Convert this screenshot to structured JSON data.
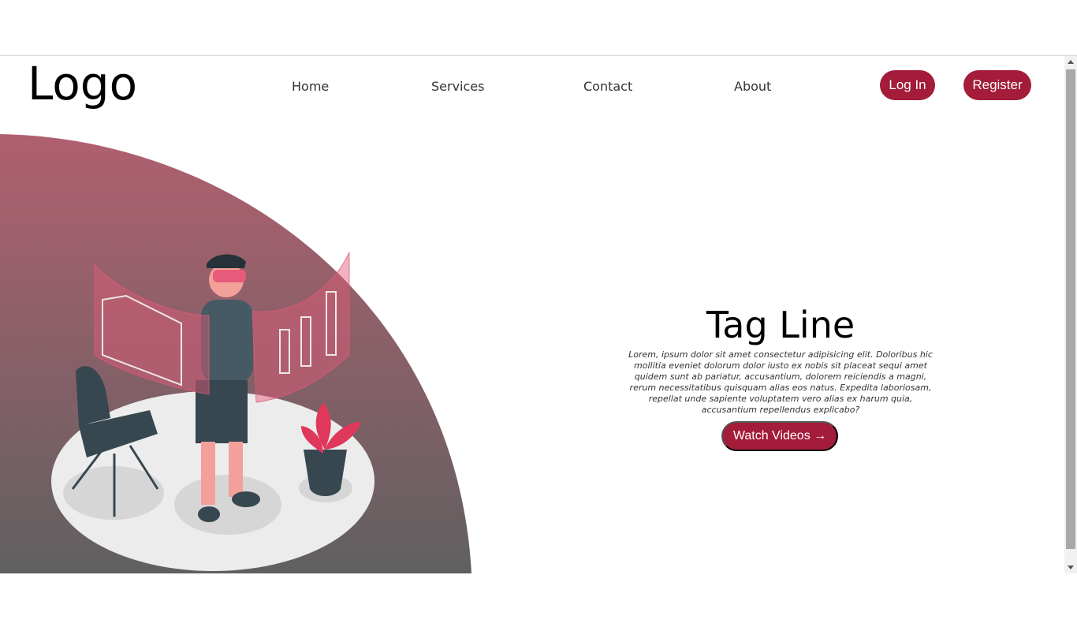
{
  "header": {
    "logo": "Logo",
    "nav": [
      "Home",
      "Services",
      "Contact",
      "About"
    ],
    "login": "Log In",
    "register": "Register"
  },
  "hero": {
    "tagline": "Tag Line",
    "description": "Lorem, ipsum dolor sit amet consectetur adipisicing elit. Doloribus hic mollitia eveniet dolorum dolor iusto ex nobis sit placeat sequi amet quidem sunt ab pariatur, accusantium, dolorem reiciendis a magni, rerum necessitatibus quisquam alias eos natus. Expedita laboriosam, repellat unde sapiente voluptatem vero alias ex harum quia, accusantium repellendus explicabo?",
    "cta": "Watch Videos →"
  },
  "colors": {
    "accent": "#a31c3a",
    "gradient_top": "#b06070",
    "gradient_bottom": "#606060"
  },
  "icons": [
    "vr-person-illustration",
    "chair-icon",
    "plant-icon",
    "chart-hologram-icon"
  ]
}
